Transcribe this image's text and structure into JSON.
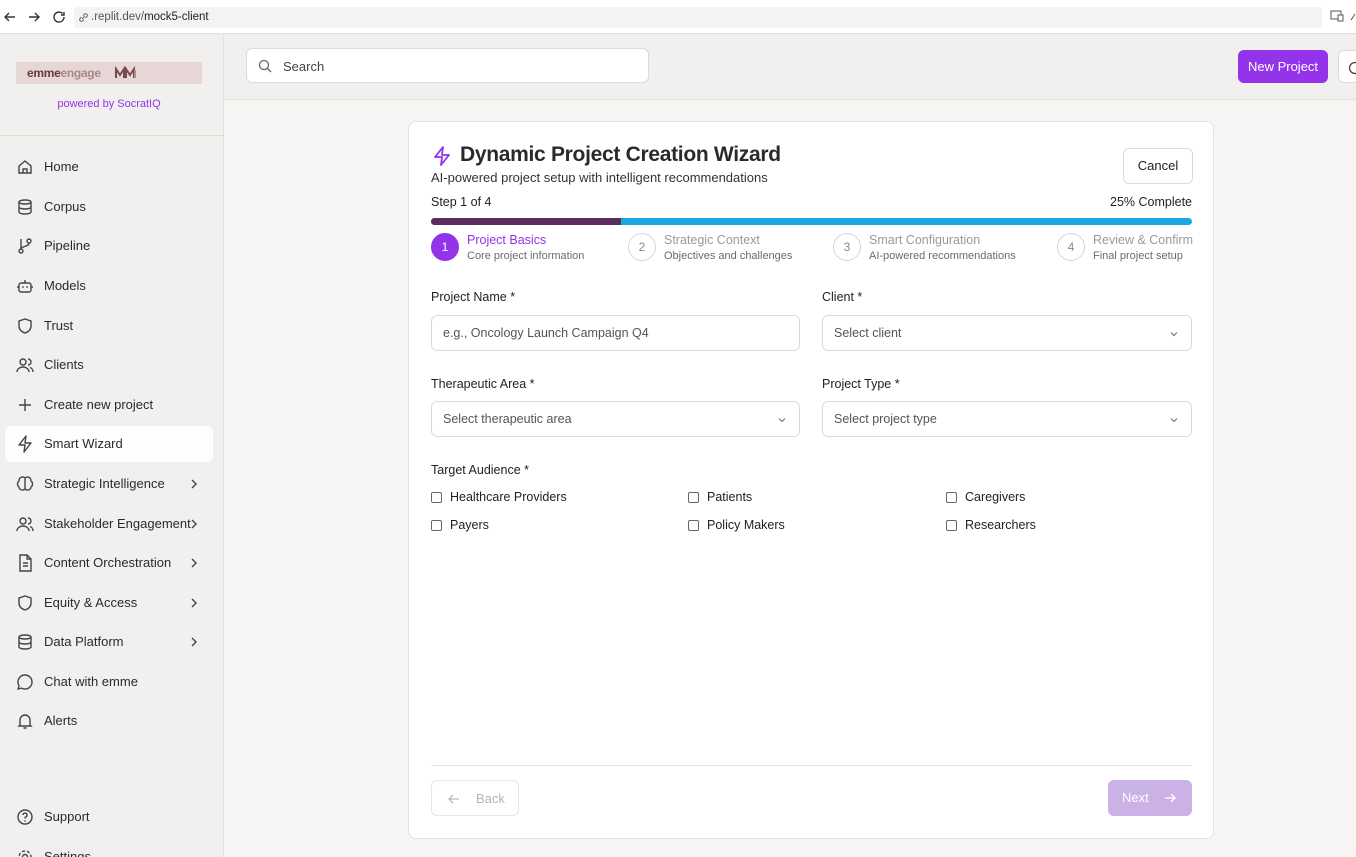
{
  "browser": {
    "url_prefix": ".replit.dev/",
    "url_path": "mock5-client"
  },
  "sidebar": {
    "brand_part1": "emme",
    "brand_part2": "engage",
    "powered_by": "powered by SocratIQ",
    "items": [
      {
        "label": "Home",
        "icon": "home-icon"
      },
      {
        "label": "Corpus",
        "icon": "database-icon"
      },
      {
        "label": "Pipeline",
        "icon": "git-branch-icon"
      },
      {
        "label": "Models",
        "icon": "bot-icon"
      },
      {
        "label": "Trust",
        "icon": "shield-icon"
      },
      {
        "label": "Clients",
        "icon": "users-icon"
      },
      {
        "label": "Create new project",
        "icon": "plus-icon"
      },
      {
        "label": "Smart Wizard",
        "icon": "zap-icon",
        "active": true
      },
      {
        "label": "Strategic Intelligence",
        "icon": "brain-icon",
        "expandable": true
      },
      {
        "label": "Stakeholder Engagement",
        "icon": "users-icon",
        "expandable": true
      },
      {
        "label": "Content Orchestration",
        "icon": "file-text-icon",
        "expandable": true
      },
      {
        "label": "Equity & Access",
        "icon": "shield-icon",
        "expandable": true
      },
      {
        "label": "Data Platform",
        "icon": "database-icon",
        "expandable": true
      },
      {
        "label": "Chat with emme",
        "icon": "message-circle-icon"
      },
      {
        "label": "Alerts",
        "icon": "bell-icon"
      },
      {
        "label": "Support",
        "icon": "help-circle-icon"
      },
      {
        "label": "Settings",
        "icon": "gear-icon"
      }
    ]
  },
  "header": {
    "search_placeholder": "Search",
    "new_project": "New Project"
  },
  "wizard": {
    "title": "Dynamic Project Creation Wizard",
    "subtitle": "AI-powered project setup with intelligent recommendations",
    "cancel": "Cancel",
    "step_text": "Step 1 of 4",
    "percent_text": "25% Complete",
    "progress": 0.25,
    "steps": [
      {
        "num": "1",
        "title": "Project Basics",
        "desc": "Core project information",
        "active": true
      },
      {
        "num": "2",
        "title": "Strategic Context",
        "desc": "Objectives and challenges"
      },
      {
        "num": "3",
        "title": "Smart Configuration",
        "desc": "AI-powered recommendations"
      },
      {
        "num": "4",
        "title": "Review & Confirm",
        "desc": "Final project setup"
      }
    ],
    "fields": {
      "project_name_label": "Project Name *",
      "project_name_placeholder": "e.g., Oncology Launch Campaign Q4",
      "client_label": "Client *",
      "client_value": "Select client",
      "therapeutic_label": "Therapeutic Area *",
      "therapeutic_value": "Select therapeutic area",
      "project_type_label": "Project Type *",
      "project_type_value": "Select project type",
      "audience_label": "Target Audience *",
      "audience_options": [
        "Healthcare Providers",
        "Patients",
        "Caregivers",
        "Payers",
        "Policy Makers",
        "Researchers"
      ]
    },
    "back": "Back",
    "next": "Next"
  },
  "colors": {
    "accent": "#9333ea",
    "progress_done": "#5a2d5e",
    "progress_track": "#19a7e0"
  }
}
